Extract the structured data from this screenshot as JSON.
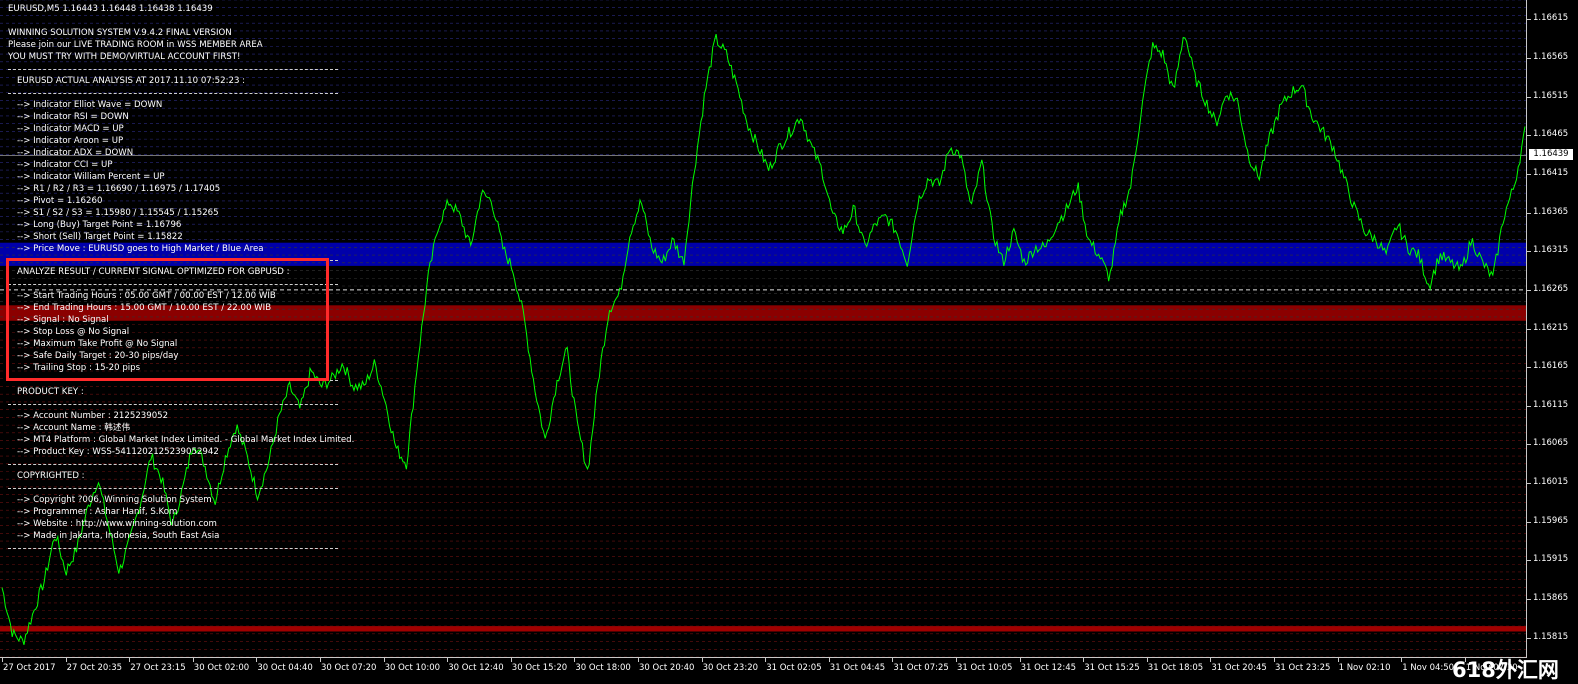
{
  "chart_header": {
    "symbol_line": "EURUSD,M5  1.16443 1.16448 1.16438 1.16439"
  },
  "panel": {
    "intro": [
      "WINNING SOLUTION SYSTEM V.9.4.2 FINAL VERSION",
      "Please join our LIVE TRADING ROOM in WSS MEMBER AREA",
      "YOU MUST TRY WITH DEMO/VIRTUAL ACCOUNT FIRST!"
    ],
    "analysis_title": "EURUSD ACTUAL ANALYSIS AT 2017.11.10 07:52:23 :",
    "analysis_items": [
      "--> Indicator Elliot Wave = DOWN",
      "--> Indicator RSI = DOWN",
      "--> Indicator MACD = UP",
      "--> Indicator Aroon = UP",
      "--> Indicator ADX = DOWN",
      "--> Indicator CCI = UP",
      "--> Indicator William Percent = UP",
      "--> R1 / R2 / R3 = 1.16690 / 1.16975 / 1.17405",
      "--> Pivot = 1.16260",
      "--> S1 / S2 / S3 = 1.15980 / 1.15545 / 1.15265",
      "--> Long (Buy) Target Point = 1.16796",
      "--> Short (Sell) Target Point = 1.15822",
      "--> Price Move : EURUSD goes to High Market / Blue Area"
    ],
    "result_title": "ANALYZE RESULT / CURRENT SIGNAL OPTIMIZED FOR GBPUSD :",
    "result_items": [
      "--> Start Trading Hours : 05.00 GMT / 00.00 EST / 12.00 WIB",
      "--> End Trading Hours : 15.00 GMT / 10.00 EST / 22.00 WIB",
      "--> Signal :  No Signal",
      "--> Stop Loss @ No Signal",
      "--> Maximum Take Profit @ No Signal",
      "--> Safe Daily Target : 20-30 pips/day",
      "--> Trailing Stop : 15-20 pips"
    ],
    "product_title": "PRODUCT KEY :",
    "product_items": [
      "--> Account Number : 2125239052",
      "--> Account Name : 韩述伟",
      "--> MT4 Platform : Global Market Index Limited. - Global Market Index Limited.",
      "--> Product Key : WSS-5411202125239052942"
    ],
    "copyright_title": "COPYRIGHTED :",
    "copyright_items": [
      "--> Copyright ?006, Winning Solution System",
      "--> Programmer : Ashar Hanif, S.Kom",
      "--> Website : http://www.winning-solution.com",
      "--> Made in Jakarta, Indonesia, South East Asia"
    ]
  },
  "price_axis": {
    "ticks": [
      "1.16615",
      "1.16565",
      "1.16515",
      "1.16465",
      "1.16415",
      "1.16365",
      "1.16315",
      "1.16265",
      "1.16215",
      "1.16165",
      "1.16115",
      "1.16065",
      "1.16015",
      "1.15965",
      "1.15915",
      "1.15865",
      "1.15815"
    ],
    "current_price": "1.16439"
  },
  "time_axis": {
    "labels": [
      "27 Oct 2017",
      "27 Oct 20:35",
      "27 Oct 23:15",
      "30 Oct 02:00",
      "30 Oct 04:40",
      "30 Oct 07:20",
      "30 Oct 10:00",
      "30 Oct 12:40",
      "30 Oct 15:20",
      "30 Oct 18:00",
      "30 Oct 20:40",
      "30 Oct 23:20",
      "31 Oct 02:05",
      "31 Oct 04:45",
      "31 Oct 07:25",
      "31 Oct 10:05",
      "31 Oct 12:45",
      "31 Oct 15:25",
      "31 Oct 18:05",
      "31 Oct 20:45",
      "31 Oct 23:25",
      "1 Nov 02:10",
      "1 Nov 04:50",
      "1 Nov 07:30"
    ]
  },
  "colors": {
    "price_line": "#00ff00",
    "blue_zone": "#0000aa",
    "red_zone": "#8b0000",
    "grid_blue": "#2a2a80",
    "grid_red": "#6a1010",
    "highlight": "#ff2a2a"
  },
  "chart_data": {
    "type": "line",
    "ylim": [
      1.1579,
      1.1664
    ],
    "zones": {
      "blue": [
        1.16296,
        1.16326
      ],
      "red": [
        1.16225,
        1.16245
      ],
      "red_low": [
        1.15823,
        1.1583
      ],
      "pivot_dashed": 1.16265,
      "current_line": 1.16439
    },
    "series": [
      {
        "values": [
          1.1588,
          1.1582,
          1.1581,
          1.1585,
          1.1589,
          1.1595,
          1.159,
          1.1593,
          1.1598,
          1.1602,
          1.1596,
          1.159,
          1.1594,
          1.1599,
          1.1605,
          1.1602,
          1.1596,
          1.1601,
          1.1607,
          1.1604,
          1.1599,
          1.1605,
          1.1609,
          1.1605,
          1.16,
          1.1604,
          1.161,
          1.1614,
          1.1611,
          1.1616,
          1.1614,
          1.1615,
          1.1617,
          1.1614,
          1.1614,
          1.1617,
          1.1612,
          1.1606,
          1.1604,
          1.1617,
          1.1628,
          1.1635,
          1.1638,
          1.1636,
          1.1632,
          1.1639,
          1.1638,
          1.1632,
          1.1629,
          1.1623,
          1.1614,
          1.1607,
          1.1614,
          1.1619,
          1.1609,
          1.1603,
          1.1615,
          1.1624,
          1.1626,
          1.1634,
          1.1638,
          1.1632,
          1.163,
          1.1633,
          1.163,
          1.1642,
          1.1652,
          1.1659,
          1.1657,
          1.1653,
          1.1648,
          1.1645,
          1.1642,
          1.1645,
          1.1647,
          1.1649,
          1.1645,
          1.1642,
          1.1636,
          1.1634,
          1.1637,
          1.1632,
          1.1635,
          1.1636,
          1.1634,
          1.163,
          1.1638,
          1.1641,
          1.164,
          1.1645,
          1.1644,
          1.1637,
          1.1643,
          1.1634,
          1.163,
          1.1634,
          1.163,
          1.1632,
          1.1632,
          1.1635,
          1.1637,
          1.164,
          1.1633,
          1.1631,
          1.1628,
          1.1636,
          1.164,
          1.165,
          1.1658,
          1.1657,
          1.1652,
          1.166,
          1.1654,
          1.1651,
          1.1648,
          1.1652,
          1.1651,
          1.1644,
          1.1641,
          1.1646,
          1.165,
          1.1652,
          1.1653,
          1.1649,
          1.1647,
          1.1645,
          1.1641,
          1.1637,
          1.1634,
          1.1633,
          1.1631,
          1.1635,
          1.1632,
          1.1631,
          1.1627,
          1.1631,
          1.163,
          1.1629,
          1.1633,
          1.163,
          1.1628,
          1.1636,
          1.164,
          1.1647
        ]
      }
    ]
  }
}
